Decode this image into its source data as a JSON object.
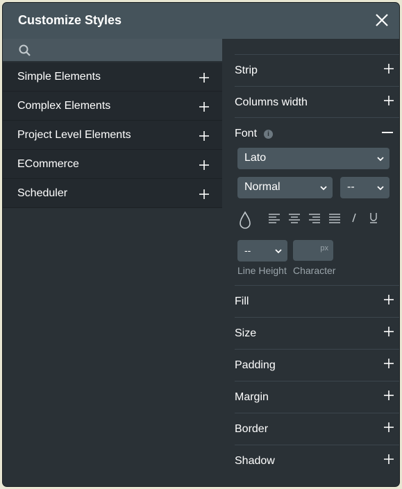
{
  "dialog": {
    "title": "Customize Styles"
  },
  "search": {
    "placeholder": ""
  },
  "categories": [
    {
      "label": "Simple Elements"
    },
    {
      "label": "Complex Elements"
    },
    {
      "label": "Project Level Elements"
    },
    {
      "label": "ECommerce"
    },
    {
      "label": "Scheduler"
    }
  ],
  "sections": {
    "strip": "Strip",
    "columns_width": "Columns width",
    "font": "Font",
    "fill": "Fill",
    "size": "Size",
    "padding": "Padding",
    "margin": "Margin",
    "border": "Border",
    "shadow": "Shadow"
  },
  "font_panel": {
    "info_glyph": "i",
    "family": "Lato",
    "weight": "Normal",
    "size": "--",
    "line_height_value": "--",
    "character_unit": "px",
    "line_height_label": "Line Height",
    "character_label": "Character"
  },
  "colors": {
    "header_bg": "#45535b",
    "panel_bg": "#2a3136",
    "list_item_bg": "#23292e",
    "input_bg": "#4a575f",
    "text": "#ffffff",
    "muted_text": "#9aa4aa"
  }
}
